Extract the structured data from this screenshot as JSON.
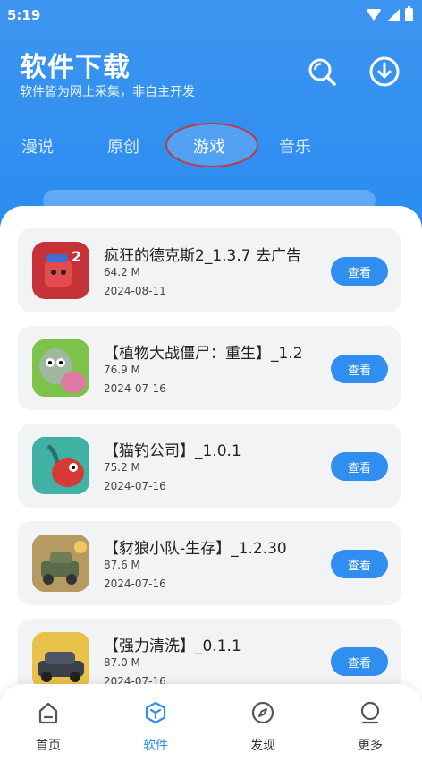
{
  "status": {
    "time": "5:19"
  },
  "header": {
    "title": "软件下载",
    "subtitle": "软件皆为网上采集，非自主开发",
    "search_icon": "search-icon",
    "download_icon": "download-icon"
  },
  "tabs": [
    {
      "label": "漫说"
    },
    {
      "label": "原创"
    },
    {
      "label": "游戏",
      "active": true
    },
    {
      "label": "音乐"
    }
  ],
  "apps": [
    {
      "name": "疯狂的德克斯2_1.3.7 去广告",
      "size": "64.2 M",
      "date": "2024-08-11",
      "button": "查看"
    },
    {
      "name": "【植物大战僵尸：重生】_1.2",
      "size": "76.9 M",
      "date": "2024-07-16",
      "button": "查看"
    },
    {
      "name": "【猫钓公司】_1.0.1",
      "size": "75.2 M",
      "date": "2024-07-16",
      "button": "查看"
    },
    {
      "name": "【豺狼小队-生存】_1.2.30",
      "size": "87.6 M",
      "date": "2024-07-16",
      "button": "查看"
    },
    {
      "name": "【强力清洗】_0.1.1",
      "size": "87.0 M",
      "date": "2024-07-16",
      "button": "查看"
    }
  ],
  "nav": [
    {
      "label": "首页",
      "icon": "home-icon"
    },
    {
      "label": "软件",
      "icon": "software-icon",
      "active": true
    },
    {
      "label": "发现",
      "icon": "compass-icon"
    },
    {
      "label": "更多",
      "icon": "more-icon"
    }
  ],
  "colors": {
    "primary": "#2f8ef0",
    "card_bg": "#f2f3f5",
    "highlight_ring": "#c0393f"
  }
}
